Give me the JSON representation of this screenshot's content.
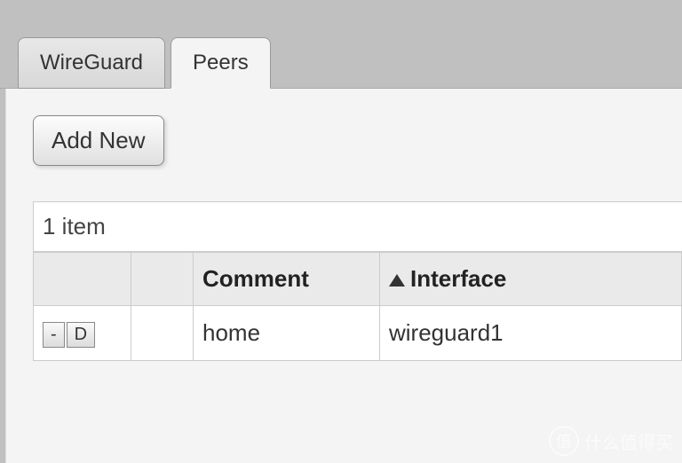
{
  "tabs": [
    {
      "label": "WireGuard",
      "active": false
    },
    {
      "label": "Peers",
      "active": true
    }
  ],
  "buttons": {
    "add_new": "Add New",
    "remove": "-",
    "disable": "D"
  },
  "item_count": "1 item",
  "columns": {
    "blank1": "",
    "blank2": "",
    "comment": "Comment",
    "interface": "Interface"
  },
  "sort": {
    "column": "interface",
    "direction": "asc"
  },
  "rows": [
    {
      "comment": "home",
      "interface": "wireguard1"
    }
  ],
  "watermark": {
    "icon": "值",
    "text": "什么值得买"
  }
}
